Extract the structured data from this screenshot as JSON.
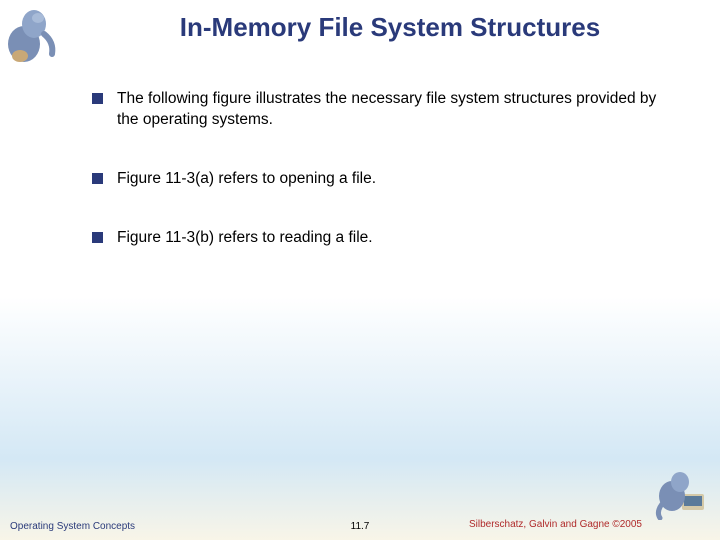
{
  "title": "In-Memory File System Structures",
  "bullets": [
    "The following figure illustrates the necessary file system structures provided by the operating systems.",
    "Figure 11-3(a) refers to opening a file.",
    "Figure 11-3(b) refers to reading a file."
  ],
  "footer": {
    "left": "Operating System Concepts",
    "center": "11.7",
    "right": "Silberschatz, Galvin and Gagne ©2005"
  }
}
